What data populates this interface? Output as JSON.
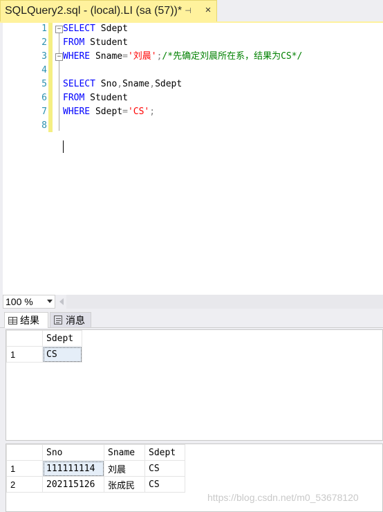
{
  "tab": {
    "title": "SQLQuery2.sql - (local).LI (sa (57))*",
    "pin": "⊣",
    "close": "×"
  },
  "editor": {
    "line_numbers": [
      "1",
      "2",
      "3",
      "4",
      "5",
      "6",
      "7",
      "8"
    ],
    "lines": [
      [
        {
          "t": "SELECT",
          "c": "kw"
        },
        {
          "t": " Sdept",
          "c": ""
        }
      ],
      [
        {
          "t": "FROM",
          "c": "kw"
        },
        {
          "t": " Student",
          "c": ""
        }
      ],
      [
        {
          "t": "WHERE",
          "c": "kw"
        },
        {
          "t": " Sname",
          "c": ""
        },
        {
          "t": "=",
          "c": "gray"
        },
        {
          "t": "'刘晨'",
          "c": "str"
        },
        {
          "t": ";",
          "c": "gray"
        },
        {
          "t": "/*先确定刘晨所在系，结果为CS*/",
          "c": "cmt"
        }
      ],
      [],
      [
        {
          "t": "SELECT",
          "c": "kw"
        },
        {
          "t": " Sno",
          "c": ""
        },
        {
          "t": ",",
          "c": "gray"
        },
        {
          "t": "Sname",
          "c": ""
        },
        {
          "t": ",",
          "c": "gray"
        },
        {
          "t": "Sdept",
          "c": ""
        }
      ],
      [
        {
          "t": "FROM",
          "c": "kw"
        },
        {
          "t": " Student",
          "c": ""
        }
      ],
      [
        {
          "t": "WHERE",
          "c": "kw"
        },
        {
          "t": " Sdept",
          "c": ""
        },
        {
          "t": "=",
          "c": "gray"
        },
        {
          "t": "'CS'",
          "c": "str"
        },
        {
          "t": ";",
          "c": "gray"
        }
      ],
      []
    ],
    "fold_collapse_glyph": "−"
  },
  "zoom": {
    "value": "100 %"
  },
  "results_tabs": {
    "results": "结果",
    "messages": "消息"
  },
  "result1": {
    "columns": [
      "Sdept"
    ],
    "rows": [
      {
        "num": "1",
        "cells": [
          "CS"
        ]
      }
    ]
  },
  "result2": {
    "columns": [
      "Sno",
      "Sname",
      "Sdept"
    ],
    "rows": [
      {
        "num": "1",
        "cells": [
          "111111114",
          "刘晨",
          "CS"
        ]
      },
      {
        "num": "2",
        "cells": [
          "202115126",
          "张成民",
          "CS"
        ]
      }
    ]
  },
  "watermark": "https://blog.csdn.net/m0_53678120",
  "colors": {
    "tab_bg": "#fff29d",
    "keyword": "#0000ff",
    "string": "#ff0000",
    "comment": "#008000",
    "line_number": "#2b91af"
  },
  "icons": {
    "results_tab": "grid-icon",
    "messages_tab": "message-icon",
    "pin": "pin-icon",
    "close": "close-icon"
  }
}
